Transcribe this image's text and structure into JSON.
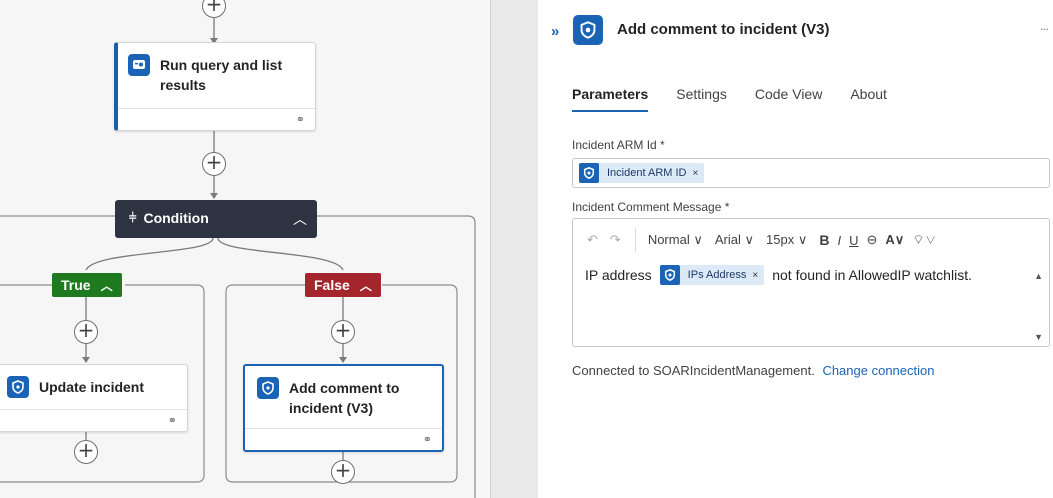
{
  "canvas": {
    "run_query_card": {
      "title": "Run query and list results"
    },
    "condition": {
      "label": "Condition"
    },
    "true_branch": {
      "label": "True"
    },
    "false_branch": {
      "label": "False"
    },
    "update_incident_card": {
      "title": "Update incident"
    },
    "add_comment_card": {
      "title": "Add comment to incident (V3)"
    },
    "plus_glyph": "+"
  },
  "panel": {
    "expand_glyph": "»",
    "title": "Add comment to incident (V3)",
    "more_glyph": "...",
    "tabs": [
      {
        "label": "Parameters",
        "active": true
      },
      {
        "label": "Settings",
        "active": false
      },
      {
        "label": "Code View",
        "active": false
      },
      {
        "label": "About",
        "active": false
      }
    ],
    "incident_arm_id": {
      "label": "Incident ARM Id *",
      "token": "Incident ARM ID"
    },
    "comment_message": {
      "label": "Incident Comment Message *",
      "toolbar": {
        "undo": "↶",
        "redo": "↷",
        "block_format": "Normal",
        "font": "Arial",
        "size": "15px",
        "bold": "B",
        "italic": "I",
        "underline": "U",
        "link": "⊖",
        "font_color": "A",
        "highlight": "⌔"
      },
      "text_before": "IP address",
      "token": "IPs Address",
      "text_after": "not found in AllowedIP watchlist."
    },
    "connection": {
      "text": "Connected to SOARIncidentManagement.",
      "link": "Change connection"
    }
  },
  "colors": {
    "accent": "#1b63b5",
    "condition_bg": "#2e3341",
    "true_green": "#1f7a1f",
    "false_red": "#a4262c"
  },
  "icons": {
    "run_query": "analytics-query-icon",
    "connector": "sentinel-shield-icon",
    "link": "chain-link-icon"
  }
}
